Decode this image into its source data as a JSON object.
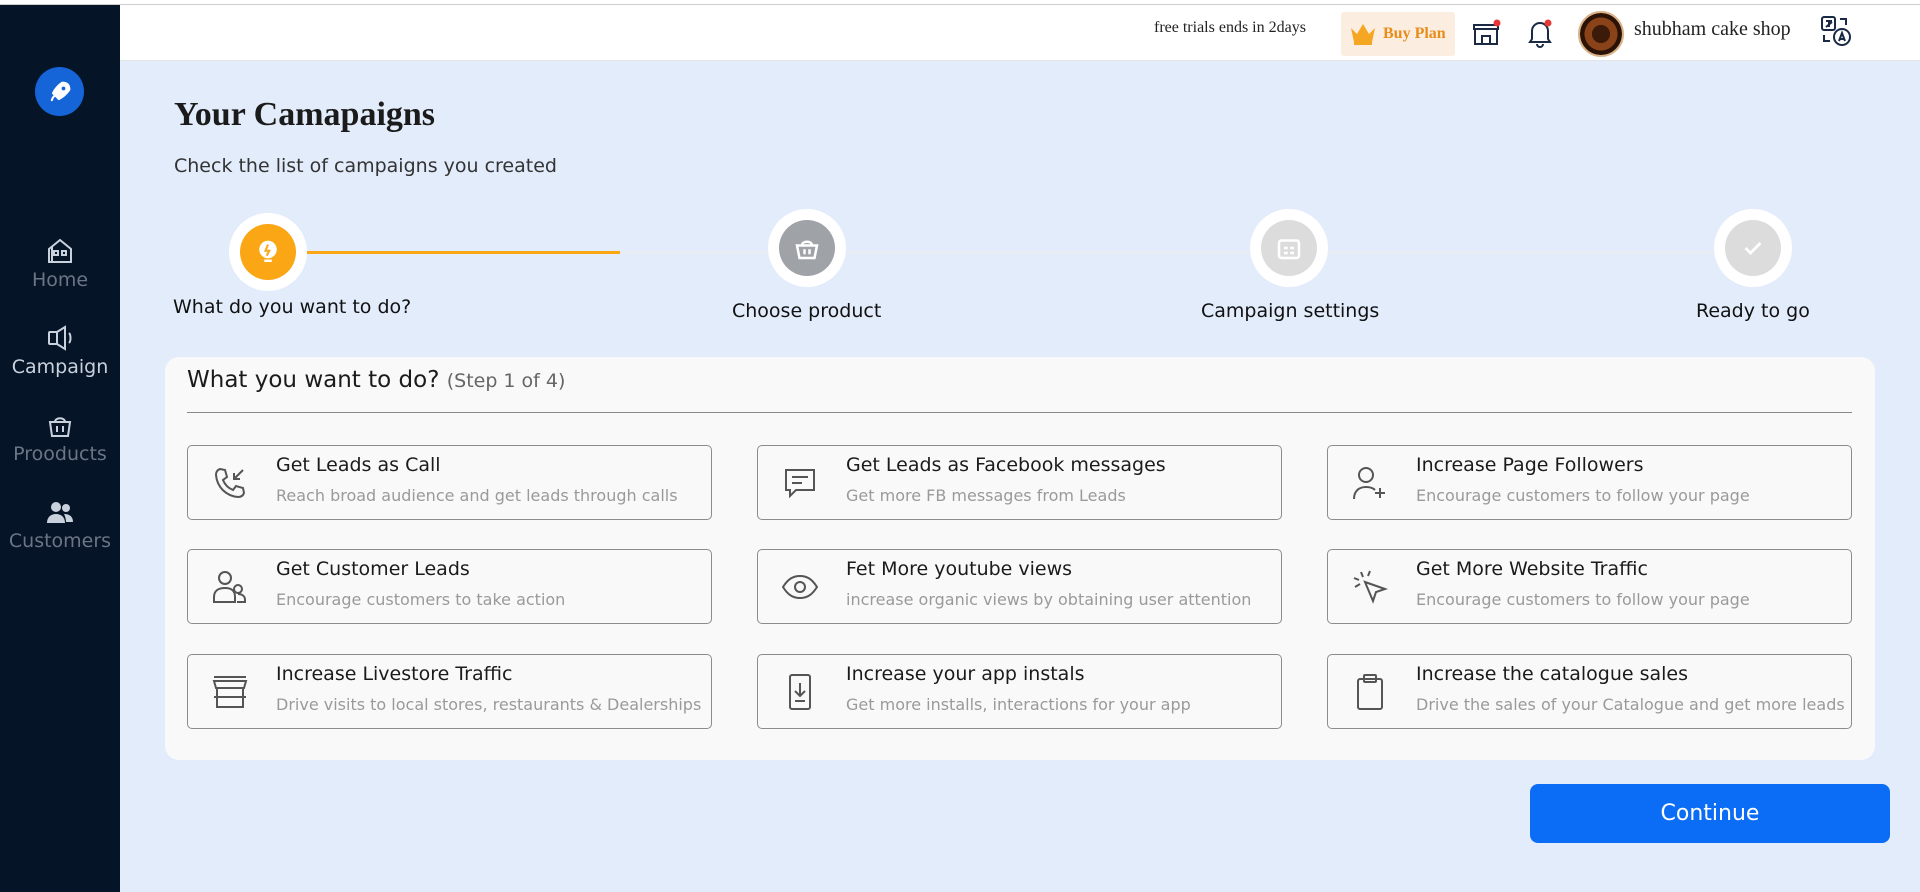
{
  "header": {
    "trial_text": "free trials ends in 2days",
    "buy_plan": "Buy Plan",
    "shop_name": "shubham cake shop"
  },
  "sidebar": {
    "items": [
      {
        "label": "Home",
        "icon": "home-icon"
      },
      {
        "label": "Campaign",
        "icon": "megaphone-icon"
      },
      {
        "label": "Prooducts",
        "icon": "basket-icon"
      },
      {
        "label": "Customers",
        "icon": "users-icon"
      }
    ]
  },
  "main": {
    "title": "Your Camapaigns",
    "subtitle": "Check the list of campaigns you created"
  },
  "stepper": {
    "steps": [
      {
        "label": "What do you want to do?",
        "icon": "lightbulb-icon",
        "state": "active"
      },
      {
        "label": "Choose product",
        "icon": "basket-icon",
        "state": "pending"
      },
      {
        "label": "Campaign settings",
        "icon": "calendar-icon",
        "state": "disabled"
      },
      {
        "label": "Ready to go",
        "icon": "check-icon",
        "state": "disabled"
      }
    ],
    "colors": {
      "active": "#fba614",
      "pending": "#9fa3a8",
      "disabled": "#dcdcdc"
    }
  },
  "card": {
    "title": "What you want to do?",
    "step": "(Step 1 of 4)",
    "options": [
      {
        "title": "Get Leads as Call",
        "desc": "Reach broad audience and get leads through calls",
        "icon": "phone-incoming-icon"
      },
      {
        "title": "Get Leads as Facebook messages",
        "desc": "Get more FB messages from Leads",
        "icon": "message-icon"
      },
      {
        "title": "Increase Page Followers",
        "desc": "Encourage customers to follow your page",
        "icon": "user-plus-icon"
      },
      {
        "title": "Get Customer Leads",
        "desc": "Encourage customers to take action",
        "icon": "users-icon"
      },
      {
        "title": "Fet More youtube views",
        "desc": "increase organic views by obtaining user attention",
        "icon": "eye-icon"
      },
      {
        "title": "Get More Website Traffic",
        "desc": "Encourage customers to follow your page",
        "icon": "cursor-click-icon"
      },
      {
        "title": "Increase Livestore Traffic",
        "desc": "Drive visits to local stores, restaurants & Dealerships",
        "icon": "store-icon"
      },
      {
        "title": "Increase your app instals",
        "desc": "Get more installs, interactions for your app",
        "icon": "mobile-download-icon"
      },
      {
        "title": "Increase the catalogue sales",
        "desc": "Drive the sales of your Catalogue and get more leads",
        "icon": "clipboard-icon"
      }
    ]
  },
  "actions": {
    "continue": "Continue"
  },
  "colors": {
    "accent": "#0b6cf5",
    "sidebar": "#061428",
    "background": "#e3ecfb",
    "buy_plan": "#e88c1a"
  }
}
